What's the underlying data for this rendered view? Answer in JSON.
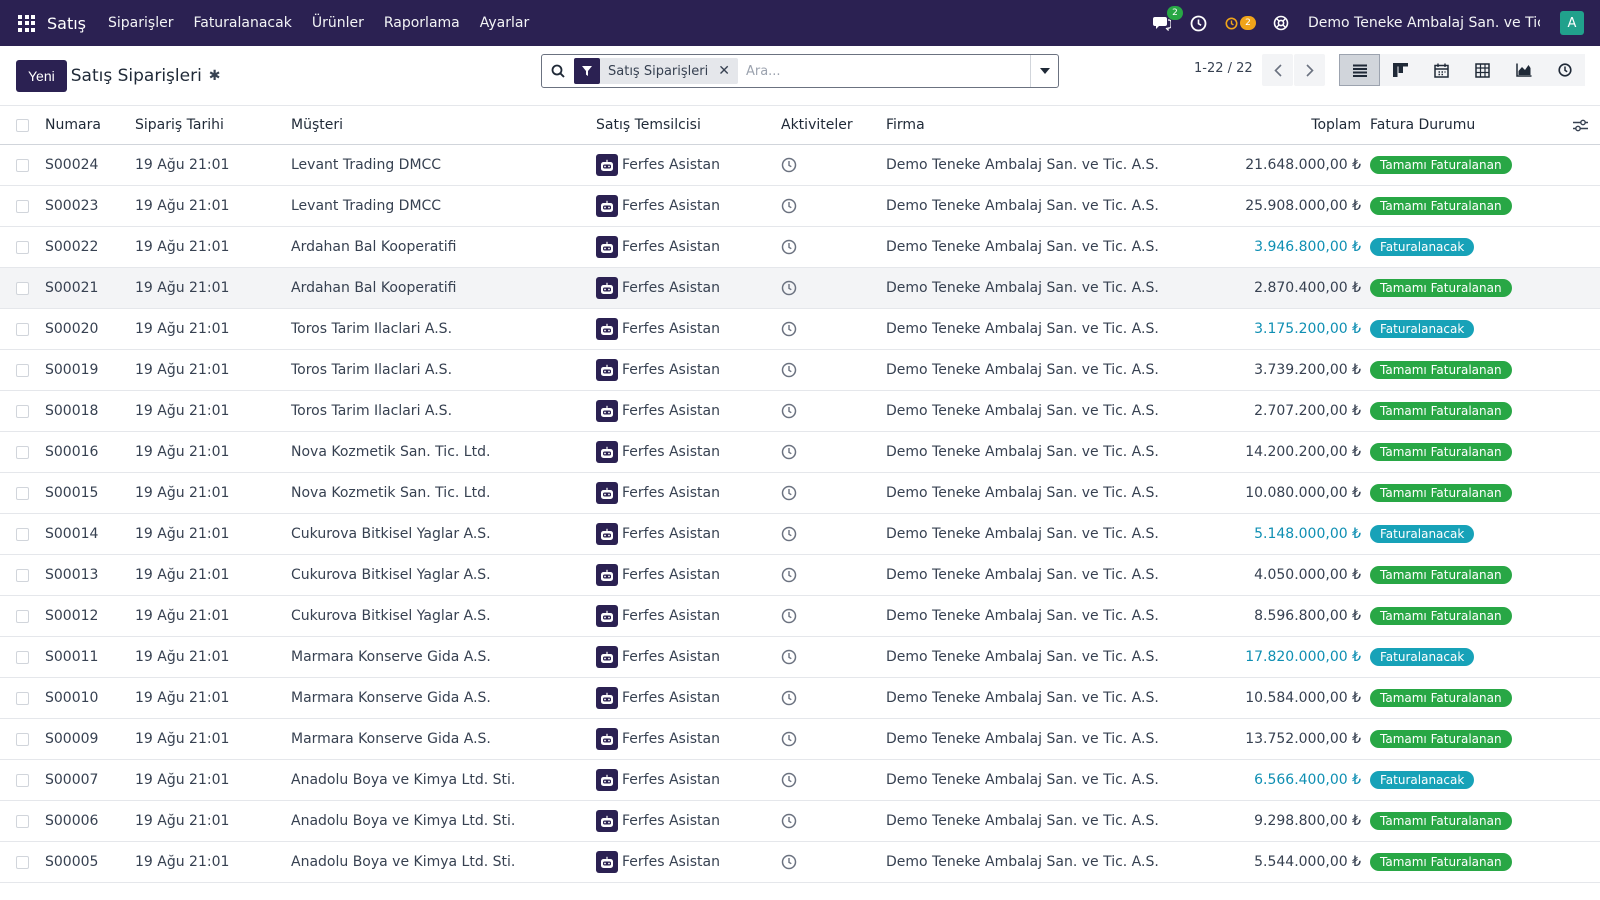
{
  "navbar": {
    "app_name": "Satış",
    "menu": [
      "Siparişler",
      "Faturalanacak",
      "Ürünler",
      "Raporlama",
      "Ayarlar"
    ],
    "messages_badge": "2",
    "activities_badge": "2",
    "company": "Demo Teneke Ambalaj San. ve Tic. ...",
    "user_initial": "A"
  },
  "control": {
    "new_label": "Yeni",
    "title": "Satış Siparişleri",
    "facet_label": "Satış Siparişleri",
    "search_placeholder": "Ara...",
    "pager": "1-22 / 22"
  },
  "table": {
    "headers": {
      "number": "Numara",
      "date": "Sipariş Tarihi",
      "customer": "Müşteri",
      "rep": "Satış Temsilcisi",
      "activities": "Aktiviteler",
      "company": "Firma",
      "total": "Toplam",
      "status": "Fatura Durumu"
    },
    "rows": [
      {
        "number": "S00024",
        "date": "19 Ağu 21:01",
        "customer": "Levant Trading DMCC",
        "rep": "Ferfes Asistan",
        "company": "Demo Teneke Ambalaj San. ve Tic. A.S.",
        "total": "21.648.000,00 ₺",
        "status": "Tamamı Faturalanan",
        "state": "done"
      },
      {
        "number": "S00023",
        "date": "19 Ağu 21:01",
        "customer": "Levant Trading DMCC",
        "rep": "Ferfes Asistan",
        "company": "Demo Teneke Ambalaj San. ve Tic. A.S.",
        "total": "25.908.000,00 ₺",
        "status": "Tamamı Faturalanan",
        "state": "done"
      },
      {
        "number": "S00022",
        "date": "19 Ağu 21:01",
        "customer": "Ardahan Bal Kooperatifi",
        "rep": "Ferfes Asistan",
        "company": "Demo Teneke Ambalaj San. ve Tic. A.S.",
        "total": "3.946.800,00 ₺",
        "status": "Faturalanacak",
        "state": "todo"
      },
      {
        "number": "S00021",
        "date": "19 Ağu 21:01",
        "customer": "Ardahan Bal Kooperatifi",
        "rep": "Ferfes Asistan",
        "company": "Demo Teneke Ambalaj San. ve Tic. A.S.",
        "total": "2.870.400,00 ₺",
        "status": "Tamamı Faturalanan",
        "state": "done"
      },
      {
        "number": "S00020",
        "date": "19 Ağu 21:01",
        "customer": "Toros Tarim Ilaclari A.S.",
        "rep": "Ferfes Asistan",
        "company": "Demo Teneke Ambalaj San. ve Tic. A.S.",
        "total": "3.175.200,00 ₺",
        "status": "Faturalanacak",
        "state": "todo"
      },
      {
        "number": "S00019",
        "date": "19 Ağu 21:01",
        "customer": "Toros Tarim Ilaclari A.S.",
        "rep": "Ferfes Asistan",
        "company": "Demo Teneke Ambalaj San. ve Tic. A.S.",
        "total": "3.739.200,00 ₺",
        "status": "Tamamı Faturalanan",
        "state": "done"
      },
      {
        "number": "S00018",
        "date": "19 Ağu 21:01",
        "customer": "Toros Tarim Ilaclari A.S.",
        "rep": "Ferfes Asistan",
        "company": "Demo Teneke Ambalaj San. ve Tic. A.S.",
        "total": "2.707.200,00 ₺",
        "status": "Tamamı Faturalanan",
        "state": "done"
      },
      {
        "number": "S00016",
        "date": "19 Ağu 21:01",
        "customer": "Nova Kozmetik San. Tic. Ltd.",
        "rep": "Ferfes Asistan",
        "company": "Demo Teneke Ambalaj San. ve Tic. A.S.",
        "total": "14.200.200,00 ₺",
        "status": "Tamamı Faturalanan",
        "state": "done"
      },
      {
        "number": "S00015",
        "date": "19 Ağu 21:01",
        "customer": "Nova Kozmetik San. Tic. Ltd.",
        "rep": "Ferfes Asistan",
        "company": "Demo Teneke Ambalaj San. ve Tic. A.S.",
        "total": "10.080.000,00 ₺",
        "status": "Tamamı Faturalanan",
        "state": "done"
      },
      {
        "number": "S00014",
        "date": "19 Ağu 21:01",
        "customer": "Cukurova Bitkisel Yaglar A.S.",
        "rep": "Ferfes Asistan",
        "company": "Demo Teneke Ambalaj San. ve Tic. A.S.",
        "total": "5.148.000,00 ₺",
        "status": "Faturalanacak",
        "state": "todo"
      },
      {
        "number": "S00013",
        "date": "19 Ağu 21:01",
        "customer": "Cukurova Bitkisel Yaglar A.S.",
        "rep": "Ferfes Asistan",
        "company": "Demo Teneke Ambalaj San. ve Tic. A.S.",
        "total": "4.050.000,00 ₺",
        "status": "Tamamı Faturalanan",
        "state": "done"
      },
      {
        "number": "S00012",
        "date": "19 Ağu 21:01",
        "customer": "Cukurova Bitkisel Yaglar A.S.",
        "rep": "Ferfes Asistan",
        "company": "Demo Teneke Ambalaj San. ve Tic. A.S.",
        "total": "8.596.800,00 ₺",
        "status": "Tamamı Faturalanan",
        "state": "done"
      },
      {
        "number": "S00011",
        "date": "19 Ağu 21:01",
        "customer": "Marmara Konserve Gida A.S.",
        "rep": "Ferfes Asistan",
        "company": "Demo Teneke Ambalaj San. ve Tic. A.S.",
        "total": "17.820.000,00 ₺",
        "status": "Faturalanacak",
        "state": "todo"
      },
      {
        "number": "S00010",
        "date": "19 Ağu 21:01",
        "customer": "Marmara Konserve Gida A.S.",
        "rep": "Ferfes Asistan",
        "company": "Demo Teneke Ambalaj San. ve Tic. A.S.",
        "total": "10.584.000,00 ₺",
        "status": "Tamamı Faturalanan",
        "state": "done"
      },
      {
        "number": "S00009",
        "date": "19 Ağu 21:01",
        "customer": "Marmara Konserve Gida A.S.",
        "rep": "Ferfes Asistan",
        "company": "Demo Teneke Ambalaj San. ve Tic. A.S.",
        "total": "13.752.000,00 ₺",
        "status": "Tamamı Faturalanan",
        "state": "done"
      },
      {
        "number": "S00007",
        "date": "19 Ağu 21:01",
        "customer": "Anadolu Boya ve Kimya Ltd. Sti.",
        "rep": "Ferfes Asistan",
        "company": "Demo Teneke Ambalaj San. ve Tic. A.S.",
        "total": "6.566.400,00 ₺",
        "status": "Faturalanacak",
        "state": "todo"
      },
      {
        "number": "S00006",
        "date": "19 Ağu 21:01",
        "customer": "Anadolu Boya ve Kimya Ltd. Sti.",
        "rep": "Ferfes Asistan",
        "company": "Demo Teneke Ambalaj San. ve Tic. A.S.",
        "total": "9.298.800,00 ₺",
        "status": "Tamamı Faturalanan",
        "state": "done"
      },
      {
        "number": "S00005",
        "date": "19 Ağu 21:01",
        "customer": "Anadolu Boya ve Kimya Ltd. Sti.",
        "rep": "Ferfes Asistan",
        "company": "Demo Teneke Ambalaj San. ve Tic. A.S.",
        "total": "5.544.000,00 ₺",
        "status": "Tamamı Faturalanan",
        "state": "done"
      }
    ]
  }
}
